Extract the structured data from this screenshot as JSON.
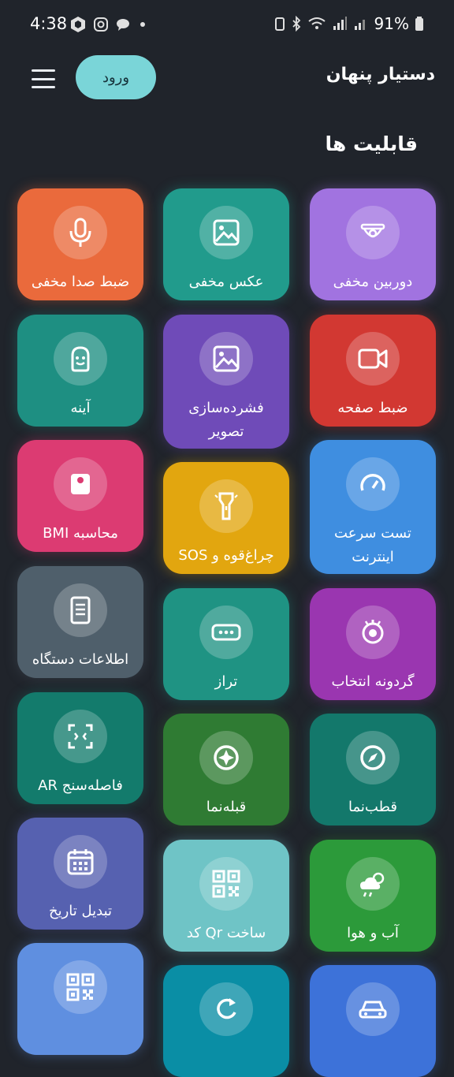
{
  "status_bar": {
    "time": "4:38",
    "battery": "91%"
  },
  "app_bar": {
    "title": "دستیار پنهان",
    "login_label": "ورود"
  },
  "section_title": "قابلیت ها",
  "tiles": [
    {
      "label": "دوربین مخفی",
      "icon": "security-camera-icon",
      "color": "#a173e0"
    },
    {
      "label": "عکس مخفی",
      "icon": "image-icon",
      "color": "#219b8c"
    },
    {
      "label": "ضبط صدا مخفی",
      "icon": "microphone-icon",
      "color": "#ea6a3c"
    },
    {
      "label": "ضبط صفحه",
      "icon": "video-camera-icon",
      "color": "#d23832"
    },
    {
      "label": "فشرده‌سازی تصویر",
      "icon": "image-icon",
      "color": "#6f4bb8"
    },
    {
      "label": "آینه",
      "icon": "face-icon",
      "color": "#1e8f82"
    },
    {
      "label": "تست سرعت اینترنت",
      "icon": "speedometer-icon",
      "color": "#3f8ee0"
    },
    {
      "label": "چراغ‌قوه و SOS",
      "icon": "flashlight-icon",
      "color": "#e2a60f"
    },
    {
      "label": "محاسبه BMI",
      "icon": "scale-icon",
      "color": "#dc3b72"
    },
    {
      "label": "گردونه انتخاب",
      "icon": "spinner-icon",
      "color": "#9a36b0"
    },
    {
      "label": "تراز",
      "icon": "level-icon",
      "color": "#1f9383"
    },
    {
      "label": "اطلاعات دستگاه",
      "icon": "document-icon",
      "color": "#4f5f6b"
    },
    {
      "label": "قطب‌نما",
      "icon": "compass-icon",
      "color": "#13786b"
    },
    {
      "label": "قبله‌نما",
      "icon": "qibla-compass-icon",
      "color": "#2f7b33"
    },
    {
      "label": "فاصله‌سنج AR",
      "icon": "scan-frame-icon",
      "color": "#137b6c"
    },
    {
      "label": "آب و هوا",
      "icon": "weather-icon",
      "color": "#2c9a3a"
    },
    {
      "label": "ساخت Qr کد",
      "icon": "qr-code-icon",
      "color": "#6fc4c6"
    },
    {
      "label": "تبدیل تاریخ",
      "icon": "calendar-icon",
      "color": "#5661b0"
    },
    {
      "label": "",
      "icon": "car-icon",
      "color": "#3d72d9"
    },
    {
      "label": "",
      "icon": "refresh-icon",
      "color": "#0a8ea5"
    },
    {
      "label": "",
      "icon": "qr-code-icon",
      "color": "#5f8fe0"
    }
  ]
}
